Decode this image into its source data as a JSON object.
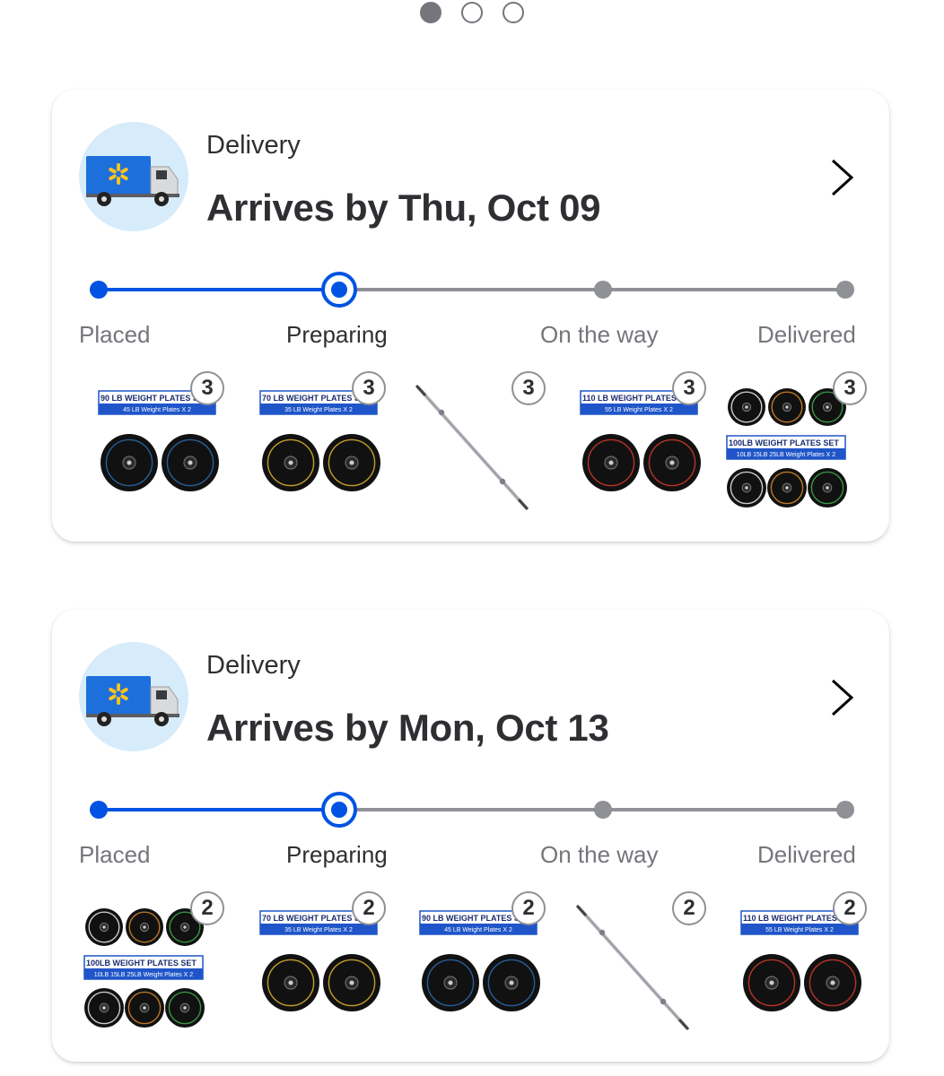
{
  "pager": {
    "count": 3,
    "active_index": 0
  },
  "colors": {
    "accent": "#0053e2",
    "text": "#2e2f32",
    "muted": "#74767c",
    "track_inactive": "#909196",
    "truck_bg": "#d7ecfa",
    "walmart_spark": "#ffc220"
  },
  "orders": [
    {
      "label": "Delivery",
      "title": "Arrives by Thu, Oct 09",
      "icon": "delivery-truck-icon",
      "steps": [
        "Placed",
        "Preparing",
        "On the way",
        "Delivered"
      ],
      "current_step": 1,
      "items": [
        {
          "type": "plate-set",
          "set_title": "90 LB WEIGHT PLATES SET",
          "set_sub": "45 LB Weight Plates X 2",
          "plate_color": "#2b6cb0",
          "qty": "3"
        },
        {
          "type": "plate-set",
          "set_title": "70 LB WEIGHT PLATES SET",
          "set_sub": "35 LB Weight Plates X 2",
          "plate_color": "#e0b62e",
          "qty": "3"
        },
        {
          "type": "barbell",
          "qty": "3"
        },
        {
          "type": "plate-set",
          "set_title": "110 LB WEIGHT PLATES SET",
          "set_sub": "55 LB Weight Plates X 2",
          "plate_color": "#d33a2c",
          "qty": "3"
        },
        {
          "type": "combo-set",
          "set_title": "100LB WEIGHT PLATES SET",
          "set_sub": "10LB 15LB 25LB Weight Plates X 2",
          "qty": "3"
        }
      ]
    },
    {
      "label": "Delivery",
      "title": "Arrives by Mon, Oct 13",
      "icon": "delivery-truck-icon",
      "steps": [
        "Placed",
        "Preparing",
        "On the way",
        "Delivered"
      ],
      "current_step": 1,
      "items": [
        {
          "type": "combo-set",
          "set_title": "100LB WEIGHT PLATES SET",
          "set_sub": "10LB 15LB 25LB Weight Plates X 2",
          "qty": "2"
        },
        {
          "type": "plate-set",
          "set_title": "70 LB WEIGHT PLATES SET",
          "set_sub": "35 LB Weight Plates X 2",
          "plate_color": "#e0b62e",
          "qty": "2"
        },
        {
          "type": "plate-set",
          "set_title": "90 LB WEIGHT PLATES SET",
          "set_sub": "45 LB Weight Plates X 2",
          "plate_color": "#2b6cb0",
          "qty": "2"
        },
        {
          "type": "barbell",
          "qty": "2"
        },
        {
          "type": "plate-set",
          "set_title": "110 LB WEIGHT PLATES SET",
          "set_sub": "55 LB Weight Plates X 2",
          "plate_color": "#d33a2c",
          "qty": "2"
        }
      ]
    }
  ]
}
